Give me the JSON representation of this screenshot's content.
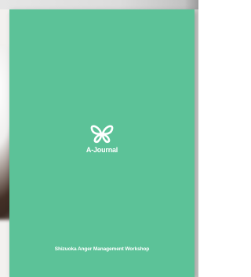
{
  "cover": {
    "background_color": "#5cc298",
    "logo_icon": "butterfly-icon",
    "title": "A-Journal",
    "footer": "Shizuoka Anger Management Workshop"
  }
}
